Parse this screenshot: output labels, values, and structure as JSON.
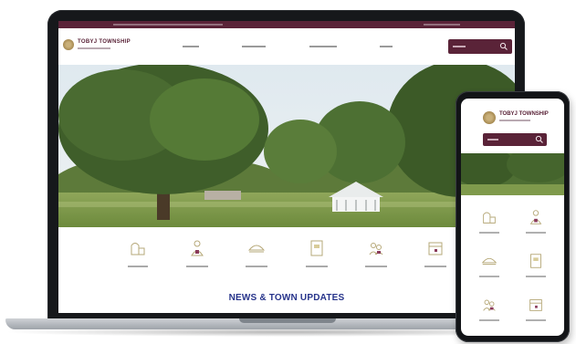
{
  "site": {
    "logo_title": "TOBYJ TOWNSHIP",
    "news_heading": "NEWS & TOWN UPDATES",
    "colors": {
      "brand": "#5a2338",
      "news_heading": "#27348b",
      "device_frame": "#16181b"
    }
  },
  "quick_links": [
    {
      "icon": "building-icon"
    },
    {
      "icon": "person-icon"
    },
    {
      "icon": "dome-icon"
    },
    {
      "icon": "document-icon"
    },
    {
      "icon": "people-icon"
    },
    {
      "icon": "calendar-icon"
    }
  ]
}
